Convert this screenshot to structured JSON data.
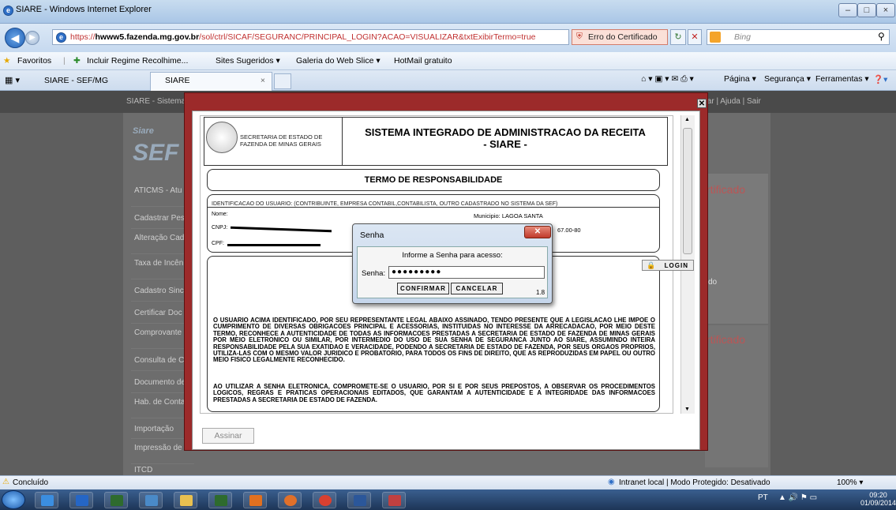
{
  "window": {
    "title": "SIARE - Windows Internet Explorer"
  },
  "address": {
    "url_prefix": "https://",
    "url_host": "hwww5.fazenda.mg.gov.br",
    "url_path": "/sol/ctrl/SICAF/SEGURANC/PRINCIPAL_LOGIN?ACAO=VISUALIZAR&txtExibirTermo=true",
    "cert_error": "Erro do Certificado",
    "search_placeholder": "Bing"
  },
  "favorites": {
    "label": "Favoritos",
    "items": [
      "Incluir Regime Recolhime...",
      "Sites Sugeridos ▾",
      "Galeria do Web Slice ▾",
      "HotMail gratuito"
    ]
  },
  "tabs": [
    {
      "label": "SIARE - SEF/MG"
    },
    {
      "label": "SIARE"
    }
  ],
  "commandbar": {
    "page": "Página ▾",
    "security": "Segurança ▾",
    "tools": "Ferramentas ▾"
  },
  "site": {
    "header_left": "SIARE - Sistema",
    "header_right": "tar | Ajuda | Sair",
    "logo": "Siare",
    "logo_big": "SEF",
    "sidebar": [
      "ATICMS - Atu ICMS vencido",
      "Cadastrar Pes",
      "Alteração Cad Gráfica Estabe",
      "Taxa de Incên Imóvel",
      "Cadastro Sinc",
      "Certificar Doc",
      "Comprovante Estadual",
      "Consulta de C",
      "Documento de",
      "Hab. de Conta Contábil",
      "Importação",
      "Impressão de Responsabilid",
      "ITCD"
    ],
    "right_text_1": "rtificado",
    "right_text_2": "rtificado",
    "right_small": "do"
  },
  "modal": {
    "secretaria": "SECRETARIA DE ESTADO DE FAZENDA DE MINAS GERAIS",
    "title_line1": "SISTEMA INTEGRADO DE ADMINISTRACAO DA RECEITA",
    "title_line2": "- SIARE -",
    "termo": "TERMO DE RESPONSABILIDADE",
    "ident": "IDENTIFICACAO DO USUARIO: (CONTRIBUINTE, EMPRESA CONTABIL,CONTABILISTA, OUTRO CADASTRADO NO SISTEMA DA SEF)",
    "nome_label": "Nome:",
    "municipio": "Municipio: LAGOA SANTA",
    "cnpj_label": "CNPJ:",
    "cpf_label": "CPF:",
    "reg_number": "67.00-80",
    "login": "LOGIN",
    "para1": "O USUARIO ACIMA IDENTIFICADO, POR SEU REPRESENTANTE LEGAL ABAIXO ASSINADO, TENDO PRESENTE QUE A LEGISLACAO LHE IMPOE O CUMPRIMENTO DE DIVERSAS OBRIGACOES PRINCIPAL E ACESSORIAS, INSTITUIDAS NO INTERESSE DA ARRECADACAO, POR MEIO DESTE TERMO, RECONHECE A AUTENTICIDADE DE TODAS AS INFORMACOES PRESTADAS A SECRETARIA DE ESTADO DE FAZENDA DE MINAS GERAIS POR MEIO ELETRONICO OU SIMILAR, POR INTERMEDIO DO USO DE SUA SENHA DE SEGURANCA JUNTO AO SIARE, ASSUMINDO INTEIRA RESPONSABILIDADE PELA SUA EXATIDAO E VERACIDADE, PODENDO A SECRETARIA DE ESTADO DE FAZENDA, POR SEUS ORGAOS PROPRIOS, UTILIZA-LAS COM O MESMO VALOR JURIDICO E PROBATORIO, PARA TODOS OS FINS DE DIREITO, QUE AS REPRODUZIDAS EM PAPEL OU OUTRO MEIO FISICO LEGALMENTE RECONHECIDO.",
    "para2": "AO UTILIZAR A SENHA ELETRONICA, COMPROMETE-SE O USUARIO, POR SI E POR SEUS PREPOSTOS, A OBSERVAR OS PROCEDIMENTOS LOGICOS, REGRAS E PRATICAS OPERACIONAIS EDITADOS, QUE GARANTAM A AUTENTICIDADE E A INTEGRIDADE DAS INFORMACOES PRESTADAS A SECRETARIA DE ESTADO DE FAZENDA.",
    "assinar": "Assinar"
  },
  "senha_dialog": {
    "title": "Senha",
    "message": "Informe a Senha para acesso:",
    "label": "Senha:",
    "value": "●●●●●●●●●",
    "confirm": "CONFIRMAR",
    "cancel": "CANCELAR",
    "version": "1.8"
  },
  "statusbar": {
    "left": "Concluído",
    "zone": "Intranet local | Modo Protegido: Desativado",
    "zoom": "100% ▾"
  },
  "taskbar": {
    "lang": "PT",
    "time": "09:20",
    "date": "01/09/2014"
  }
}
